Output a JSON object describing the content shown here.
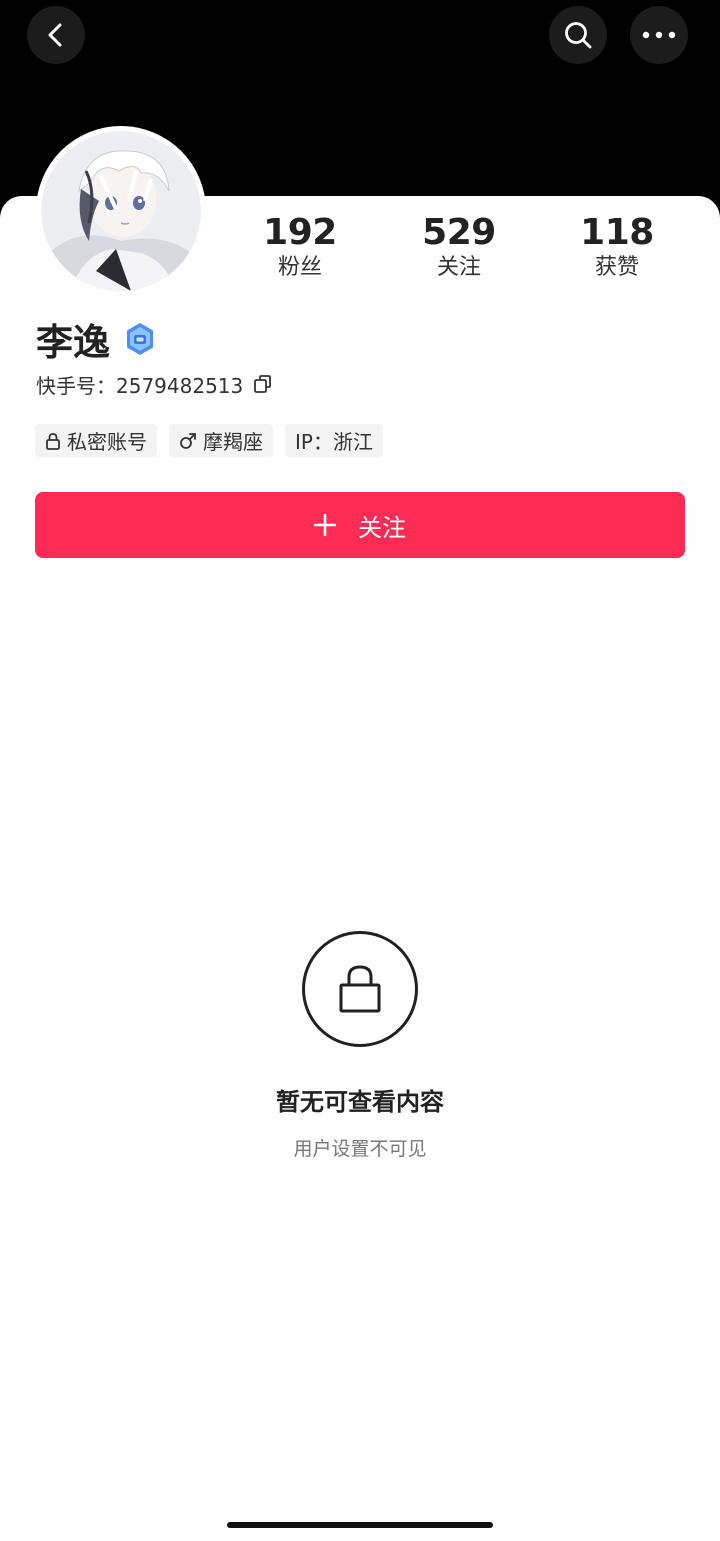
{
  "header": {
    "back_icon": "chevron-left-icon",
    "search_icon": "search-icon",
    "more_icon": "more-horizontal-icon"
  },
  "profile": {
    "avatar_icon": "avatar-image",
    "name": "李逸",
    "badge_icon": "verified-badge-icon",
    "id_text": "快手号：2579482513",
    "copy_icon": "copy-icon",
    "stats": [
      {
        "value": "192",
        "label": "粉丝"
      },
      {
        "value": "529",
        "label": "关注"
      },
      {
        "value": "118",
        "label": "获赞"
      }
    ],
    "tags": [
      {
        "icon": "lock-icon",
        "label": "私密账号"
      },
      {
        "icon": "male-icon",
        "label": "摩羯座"
      },
      {
        "icon": "",
        "label": "IP：浙江"
      }
    ]
  },
  "actions": {
    "follow_label": "关注",
    "follow_icon": "plus-icon"
  },
  "empty_state": {
    "icon": "lock-icon",
    "title": "暂无可查看内容",
    "subtitle": "用户设置不可见"
  },
  "colors": {
    "accent": "#fe2c55",
    "background_top": "#000000",
    "sheet": "#ffffff"
  }
}
